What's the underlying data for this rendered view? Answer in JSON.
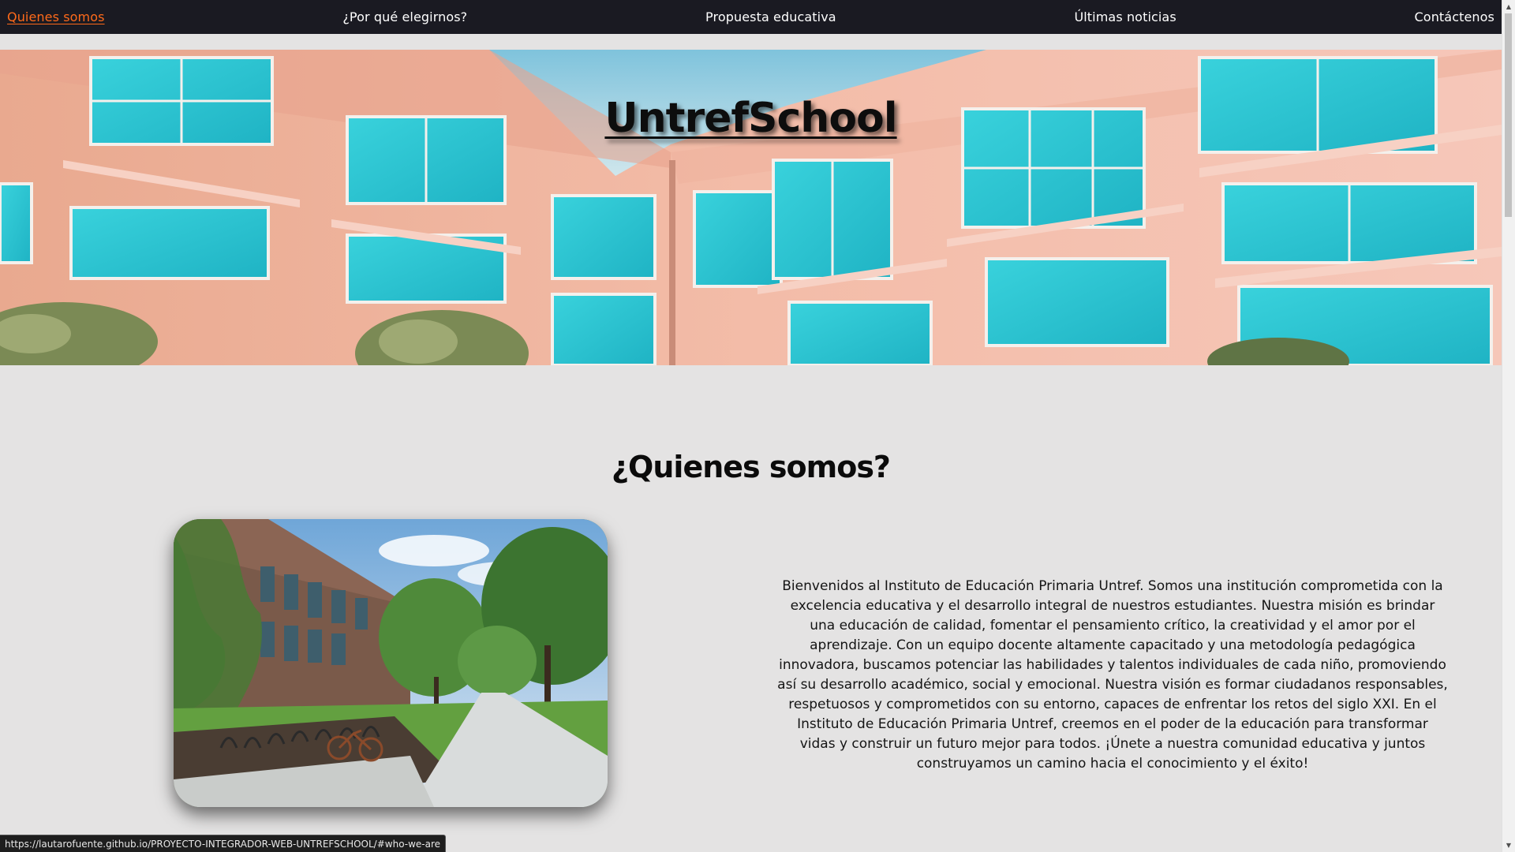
{
  "nav": {
    "items": [
      {
        "label": "Quienes somos",
        "active": true
      },
      {
        "label": "¿Por qué elegirnos?",
        "active": false
      },
      {
        "label": "Propuesta educativa",
        "active": false
      },
      {
        "label": "Últimas noticias",
        "active": false
      },
      {
        "label": "Contáctenos",
        "active": false
      }
    ],
    "active_color": "#ff6a1a",
    "background": "#1a1a22"
  },
  "hero": {
    "title": "UntrefSchool"
  },
  "about": {
    "heading": "¿Quienes somos?",
    "text": "Bienvenidos al Instituto de Educación Primaria Untref. Somos una institución comprometida con la excelencia educativa y el desarrollo integral de nuestros estudiantes. Nuestra misión es brindar una educación de calidad, fomentar el pensamiento crítico, la creatividad y el amor por el aprendizaje. Con un equipo docente altamente capacitado y una metodología pedagógica innovadora, buscamos potenciar las habilidades y talentos individuales de cada niño, promoviendo así su desarrollo académico, social y emocional. Nuestra visión es formar ciudadanos responsables, respetuosos y comprometidos con su entorno, capaces de enfrentar los retos del siglo XXI. En el Instituto de Educación Primaria Untref, creemos en el poder de la educación para transformar vidas y construir un futuro mejor para todos. ¡Únete a nuestra comunidad educativa y juntos construyamos un camino hacia el conocimiento y el éxito!"
  },
  "status_bar": {
    "url": "https://lautarofuente.github.io/PROYECTO-INTEGRADOR-WEB-UNTREFSCHOOL/#who-we-are"
  },
  "page_background": "#e4e3e3"
}
